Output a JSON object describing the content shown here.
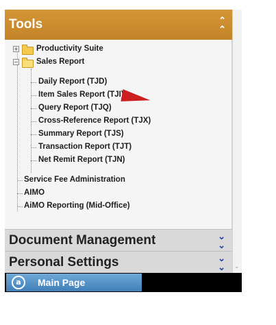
{
  "tools": {
    "title": "Tools",
    "collapse_icon": "chevron-double-up-icon"
  },
  "tree": {
    "productivity": {
      "label": "Productivity Suite",
      "expanded": false
    },
    "sales": {
      "label": "Sales Report",
      "expanded": true,
      "children": [
        "Daily Report (TJD)",
        "Item Sales Report (TJI)",
        "Query Report (TJQ)",
        "Cross-Reference Report (TJX)",
        "Summary Report (TJS)",
        "Transaction Report (TJT)",
        "Net Remit Report (TJN)"
      ]
    },
    "top_items": [
      "Service Fee Administration",
      "AIMO",
      "AiMO Reporting (Mid-Office)"
    ]
  },
  "sections": {
    "document_management": {
      "label": "Document Management",
      "icon": "chevron-double-down-icon"
    },
    "personal_settings": {
      "label": "Personal Settings",
      "icon": "chevron-double-down-icon"
    }
  },
  "bottom": {
    "main_page_label": "Main Page",
    "main_page_icon_glyph": "a"
  },
  "colors": {
    "tools_header": "#c98a2e",
    "section_bg": "#d9d9d9",
    "chevron_blue": "#1f45a8",
    "main_tab": "#5b97cc",
    "pointer_red": "#cc1f1f"
  }
}
